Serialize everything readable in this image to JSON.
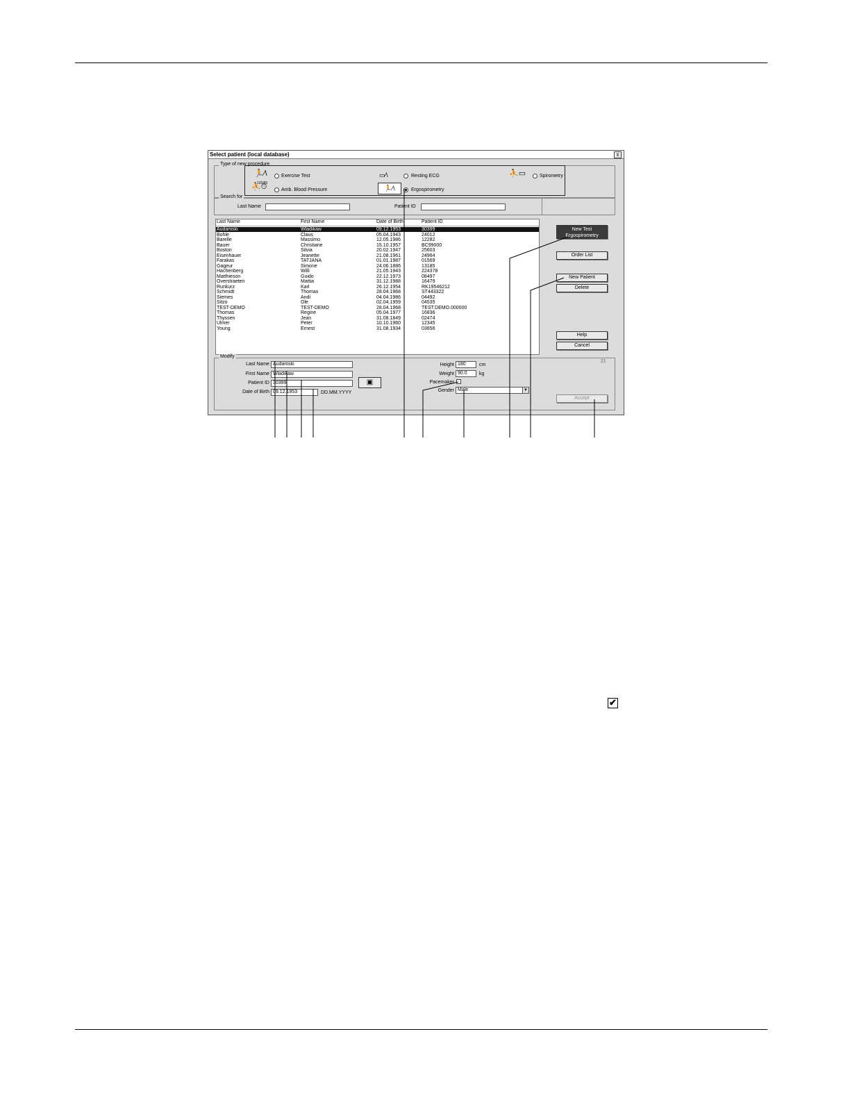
{
  "window": {
    "title": "Select patient (local database)",
    "close_label": "x"
  },
  "procedure": {
    "group_label": "Type of new procedure",
    "options": [
      {
        "label": "Exercise Test",
        "selected": false,
        "icon": "running-person-ecg-icon"
      },
      {
        "label": "Resting ECG",
        "selected": false,
        "icon": "lying-person-ecg-icon"
      },
      {
        "label": "Spirometry",
        "selected": false,
        "icon": "spirometry-icon"
      },
      {
        "label": "Amb. Blood Pressure",
        "selected": false,
        "icon": "blood-pressure-icon"
      },
      {
        "label": "Ergospirometry",
        "selected": true,
        "icon": "ergospirometry-icon"
      }
    ],
    "bp_icon_text": "120/80"
  },
  "search": {
    "group_label": "Search for",
    "last_name_label": "Last Name",
    "last_name_value": "",
    "patient_id_label": "Patient ID",
    "patient_id_value": ""
  },
  "patients": {
    "columns": [
      "Last Name",
      "First Name",
      "Date of Birth",
      "Patient ID"
    ],
    "rows": [
      [
        "Audamski",
        "Wladikaw",
        "09.12.1953",
        "30399"
      ],
      [
        "Bohle",
        "Claus",
        "05.04.1943",
        "24012"
      ],
      [
        "Barelle",
        "Massimo",
        "12.05.1986",
        "12282"
      ],
      [
        "Bauer",
        "Christiane",
        "15.10.1957",
        "BC99000"
      ],
      [
        "Boston",
        "Silvia",
        "20.02.1947",
        "25603"
      ],
      [
        "Eisenhauer",
        "Jeanette",
        "21.08.1961",
        "24964"
      ],
      [
        "Farakas",
        "TATJANA",
        "01.01.1987",
        "01569"
      ],
      [
        "Gageur",
        "Simone",
        "24.06.1886",
        "13185"
      ],
      [
        "Hachenberg",
        "Willi",
        "21.05.1943",
        "224378"
      ],
      [
        "Matthieson",
        "Guido",
        "22.12.1973",
        "08497"
      ],
      [
        "Overstraeten",
        "Mattia",
        "31.12.1988",
        "16479"
      ],
      [
        "Runkurz",
        "Karl",
        "26.12.1954",
        "RK19546212"
      ],
      [
        "Schmidt",
        "Thomas",
        "28.04.1968",
        "ST443322"
      ],
      [
        "Siemes",
        "Andi",
        "04.04.1986",
        "04492"
      ],
      [
        "Sitzo",
        "Ole",
        "02.04.1959",
        "04535"
      ],
      [
        "TEST-DEMO",
        "TEST-DEMO",
        "28.04.1968",
        "TEST.DEMO.000000"
      ],
      [
        "Thomas",
        "Regine",
        "05.04.1977",
        "16836"
      ],
      [
        "Thyssen",
        "Jean",
        "31.08.1849",
        "02474"
      ],
      [
        "Ulmer",
        "Peter",
        "10.10.1960",
        "12345"
      ],
      [
        "Young",
        "Ernest",
        "31.08.1934",
        "03656"
      ]
    ],
    "selected_index": 0
  },
  "buttons": {
    "new_test_line1": "New Test",
    "new_test_line2": "Ergospirometry",
    "order_list": "Order List",
    "new_patient": "New Patient",
    "delete": "Delete",
    "help": "Help",
    "cancel": "Cancel",
    "accept": "Accept",
    "card_reader_icon": "card-reader-icon"
  },
  "modify": {
    "group_label": "Modify",
    "corner_text": "21",
    "last_name_label": "Last Name",
    "last_name_value": "Audamski",
    "first_name_label": "First Name",
    "first_name_value": "Wladikaw",
    "patient_id_label": "Patient ID",
    "patient_id_value": "30399",
    "dob_label": "Date of Birth",
    "dob_value": "09.12.1953",
    "dob_format": "DD.MM.YYYY",
    "height_label": "Height",
    "height_value": "180",
    "height_unit": "cm",
    "weight_label": "Weight",
    "weight_value": "90.0",
    "weight_unit": "kg",
    "pacemaker_label": "Pacemaker",
    "pacemaker_checked": false,
    "gender_label": "Gender",
    "gender_value": "Male"
  },
  "page": {
    "checkmark_icon": "checkbox-checked-icon",
    "check_glyph": "✔"
  }
}
